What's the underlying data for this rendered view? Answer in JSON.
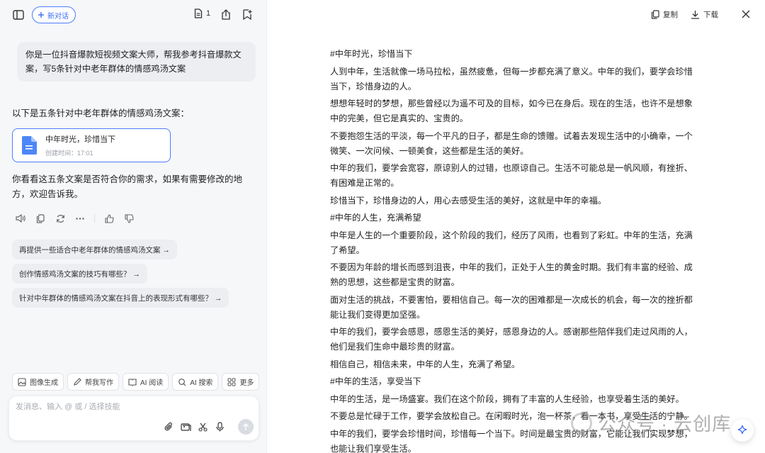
{
  "header": {
    "new_chat_label": "新对话",
    "doc_count": "1"
  },
  "chat": {
    "user_message": "你是一位抖音爆款短视频文案大师，帮我参考抖音爆款文案，写5条针对中老年群体的情感鸡汤文案",
    "intro": "以下是五条针对中老年群体的情感鸡汤文案：",
    "file_card": {
      "title": "中年时光，珍惜当下",
      "meta": "创建时间：17:01"
    },
    "reply": "你看看这五条文案是否符合你的需求，如果有需要修改的地方，欢迎告诉我。"
  },
  "suggestions": [
    "再提供一些适合中老年群体的情感鸡汤文案 →",
    "创作情感鸡汤文案的技巧有哪些？ →",
    "针对中年群体的情感鸡汤文案在抖音上的表现形式有哪些？ →"
  ],
  "tools": [
    "图像生成",
    "帮我写作",
    "AI 阅读",
    "AI 搜索",
    "更多"
  ],
  "input": {
    "placeholder": "发消息、输入 @ 或 / 选择技能"
  },
  "doc_toolbar": {
    "copy_label": "复制",
    "download_label": "下载"
  },
  "document": [
    "#中年时光，珍惜当下",
    "人到中年，生活就像一场马拉松，虽然疲惫，但每一步都充满了意义。中年的我们，要学会珍惜当下，珍惜身边的人。",
    "想想年轻时的梦想，那些曾经以为遥不可及的目标，如今已在身后。现在的生活，也许不是想象中的完美，但它是真实的、宝贵的。",
    "不要抱怨生活的平淡，每一个平凡的日子，都是生命的馈赠。试着去发现生活中的小确幸，一个微笑、一次问候、一顿美食，这些都是生活的美好。",
    "中年的我们，要学会宽容，原谅别人的过错，也原谅自己。生活不可能总是一帆风顺，有挫折、有困难是正常的。",
    "珍惜当下，珍惜身边的人，用心去感受生活的美好，这就是中年的幸福。",
    "#中年的人生，充满希望",
    "中年是人生的一个重要阶段，这个阶段的我们，经历了风雨，也看到了彩虹。中年的生活，充满了希望。",
    "不要因为年龄的增长而感到沮丧，中年的我们，正处于人生的黄金时期。我们有丰富的经验、成熟的思想，这些都是宝贵的财富。",
    "面对生活的挑战，不要害怕，要相信自己。每一次的困难都是一次成长的机会，每一次的挫折都能让我们变得更加坚强。",
    "中年的我们，要学会感恩，感恩生活的美好，感恩身边的人。感谢那些陪伴我们走过风雨的人，他们是我们生命中最珍贵的财富。",
    "相信自己，相信未来，中年的人生，充满了希望。",
    "#中年的生活，享受当下",
    "中年的生活，是一场盛宴。我们在这个阶段，拥有了丰富的人生经验，也享受着生活的美好。",
    "不要总是忙碌于工作，要学会放松自己。在闲暇时光，泡一杯茶，看一本书，享受生活的宁静。",
    "中年的我们，要学会珍惜时间，珍惜每一个当下。时间是最宝贵的财富，它能让我们实现梦想，也能让我们享受生活。"
  ],
  "watermark": "公众号 · 云创库"
}
